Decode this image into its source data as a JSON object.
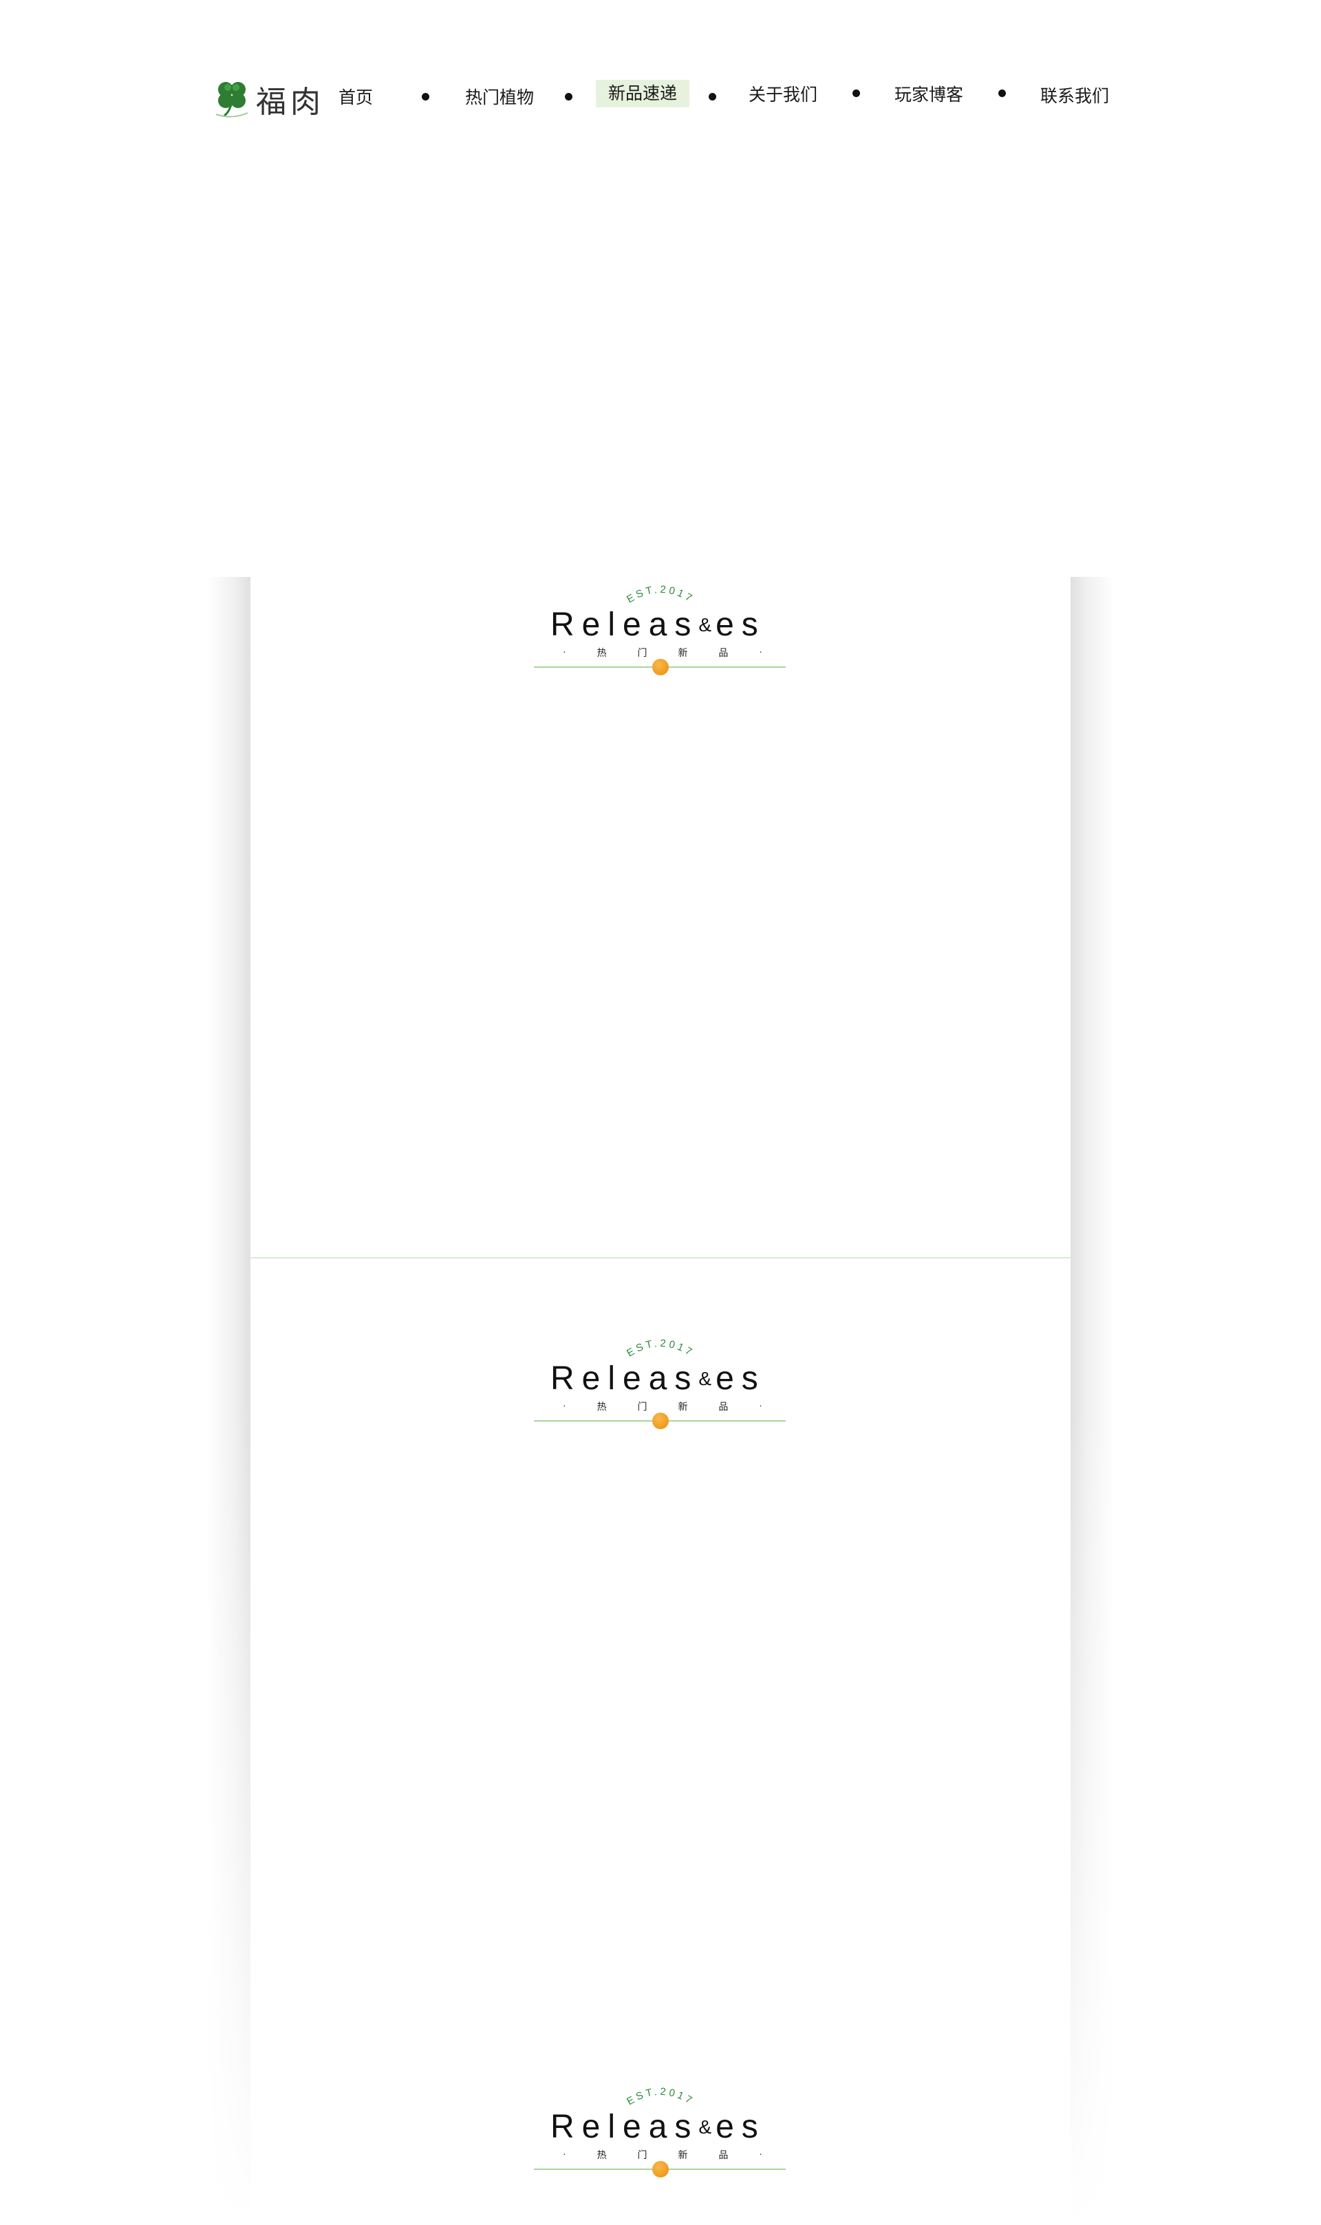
{
  "brand": {
    "name": "福肉",
    "logo_icon": "four-leaf-clover-icon"
  },
  "nav": {
    "items": [
      {
        "label": "首页",
        "active": false
      },
      {
        "label": "热门植物",
        "active": false
      },
      {
        "label": "新品速递",
        "active": true
      },
      {
        "label": "关于我们",
        "active": false
      },
      {
        "label": "玩家博客",
        "active": false
      },
      {
        "label": "联系我们",
        "active": false
      }
    ],
    "active_bg": "#e6f2dd"
  },
  "sections": [
    {
      "est": "EST.2017",
      "title_pre": "Releas",
      "title_amp": "&",
      "title_post": "es",
      "subtitle": [
        "·",
        "热",
        "门",
        "新",
        "品",
        "·"
      ]
    },
    {
      "est": "EST.2017",
      "title_pre": "Releas",
      "title_amp": "&",
      "title_post": "es",
      "subtitle": [
        "·",
        "热",
        "门",
        "新",
        "品",
        "·"
      ]
    },
    {
      "est": "EST.2017",
      "title_pre": "Releas",
      "title_amp": "&",
      "title_post": "es",
      "subtitle": [
        "·",
        "热",
        "门",
        "新",
        "品",
        "·"
      ]
    }
  ],
  "colors": {
    "accent_green": "#2e8b3c",
    "line_green": "#a8d69a",
    "dot_orange": "#ef9a1e"
  }
}
